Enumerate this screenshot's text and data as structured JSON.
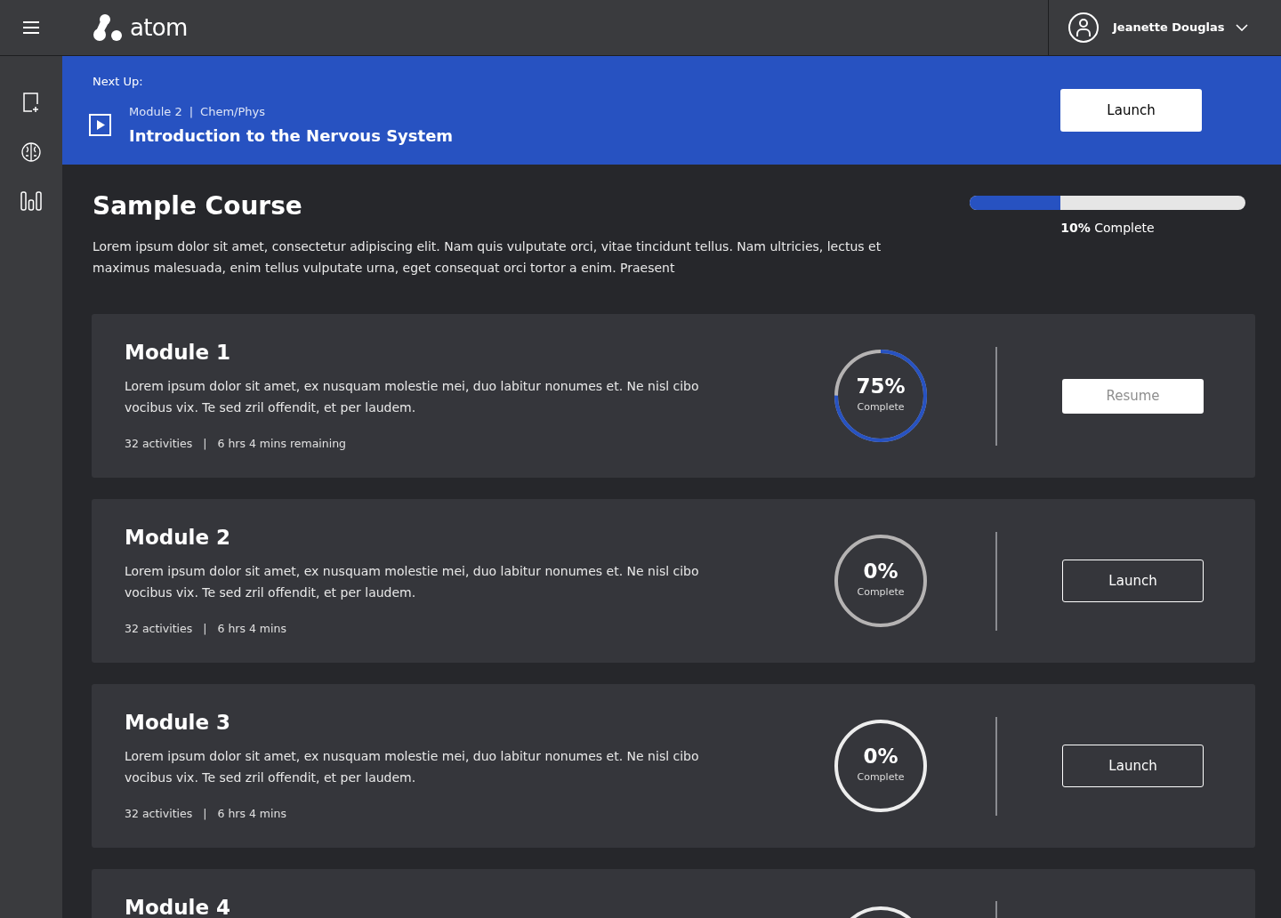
{
  "header": {
    "user": "Jeanette Douglas",
    "logo": "atom"
  },
  "next_up": {
    "label": "Next Up:",
    "module": "Module 2",
    "separator": "|",
    "subject": "Chem/Phys",
    "title": "Introduction to the Nervous System",
    "button": "Launch"
  },
  "course": {
    "title": "Sample Course",
    "description": "Lorem ipsum dolor sit amet, consectetur adipiscing elit. Nam quis vulputate orci, vitae tincidunt tellus. Nam ultricies, lectus et maximus malesuada, enim tellus vulputate urna, eget consequat orci tortor a enim. Praesent",
    "progress": {
      "level": 0.33,
      "label": "**10%** Complete"
    }
  },
  "modules": [
    {
      "title": "Module 1",
      "description": "Lorem ipsum dolor sit amet, ex nusquam molestie mei, duo labitur nonumes et. Ne nisl cibo vocibus vix. Te sed zril offendit, et per laudem.",
      "activities": "32 activities",
      "separator": "|",
      "time": "6 hrs 4 mins remaining",
      "percent": "75%",
      "complete": "Complete",
      "level": 0.75,
      "color": "#b5b3b3",
      "button": "Resume",
      "disabled": true
    },
    {
      "title": "Module 2",
      "description": "Lorem ipsum dolor sit amet, ex nusquam molestie mei, duo labitur nonumes et. Ne nisl cibo vocibus vix. Te sed zril offendit, et per laudem.",
      "activities": "32 activities",
      "separator": "|",
      "time": "6 hrs 4 mins",
      "percent": "0%",
      "complete": "Complete",
      "color": "#b5b3b3",
      "button": "Launch",
      "disabled": false
    },
    {
      "title": "Module 3",
      "description": "Lorem ipsum dolor sit amet, ex nusquam molestie mei, duo labitur nonumes et. Ne nisl cibo vocibus vix. Te sed zril offendit, et per laudem.",
      "activities": "32 activities",
      "separator": "|",
      "time": "6 hrs 4 mins",
      "percent": "0%",
      "complete": "Complete",
      "color": "#ededed",
      "button": "Launch",
      "disabled": false
    },
    {
      "title": "Module 4",
      "color": "#ededed"
    }
  ]
}
